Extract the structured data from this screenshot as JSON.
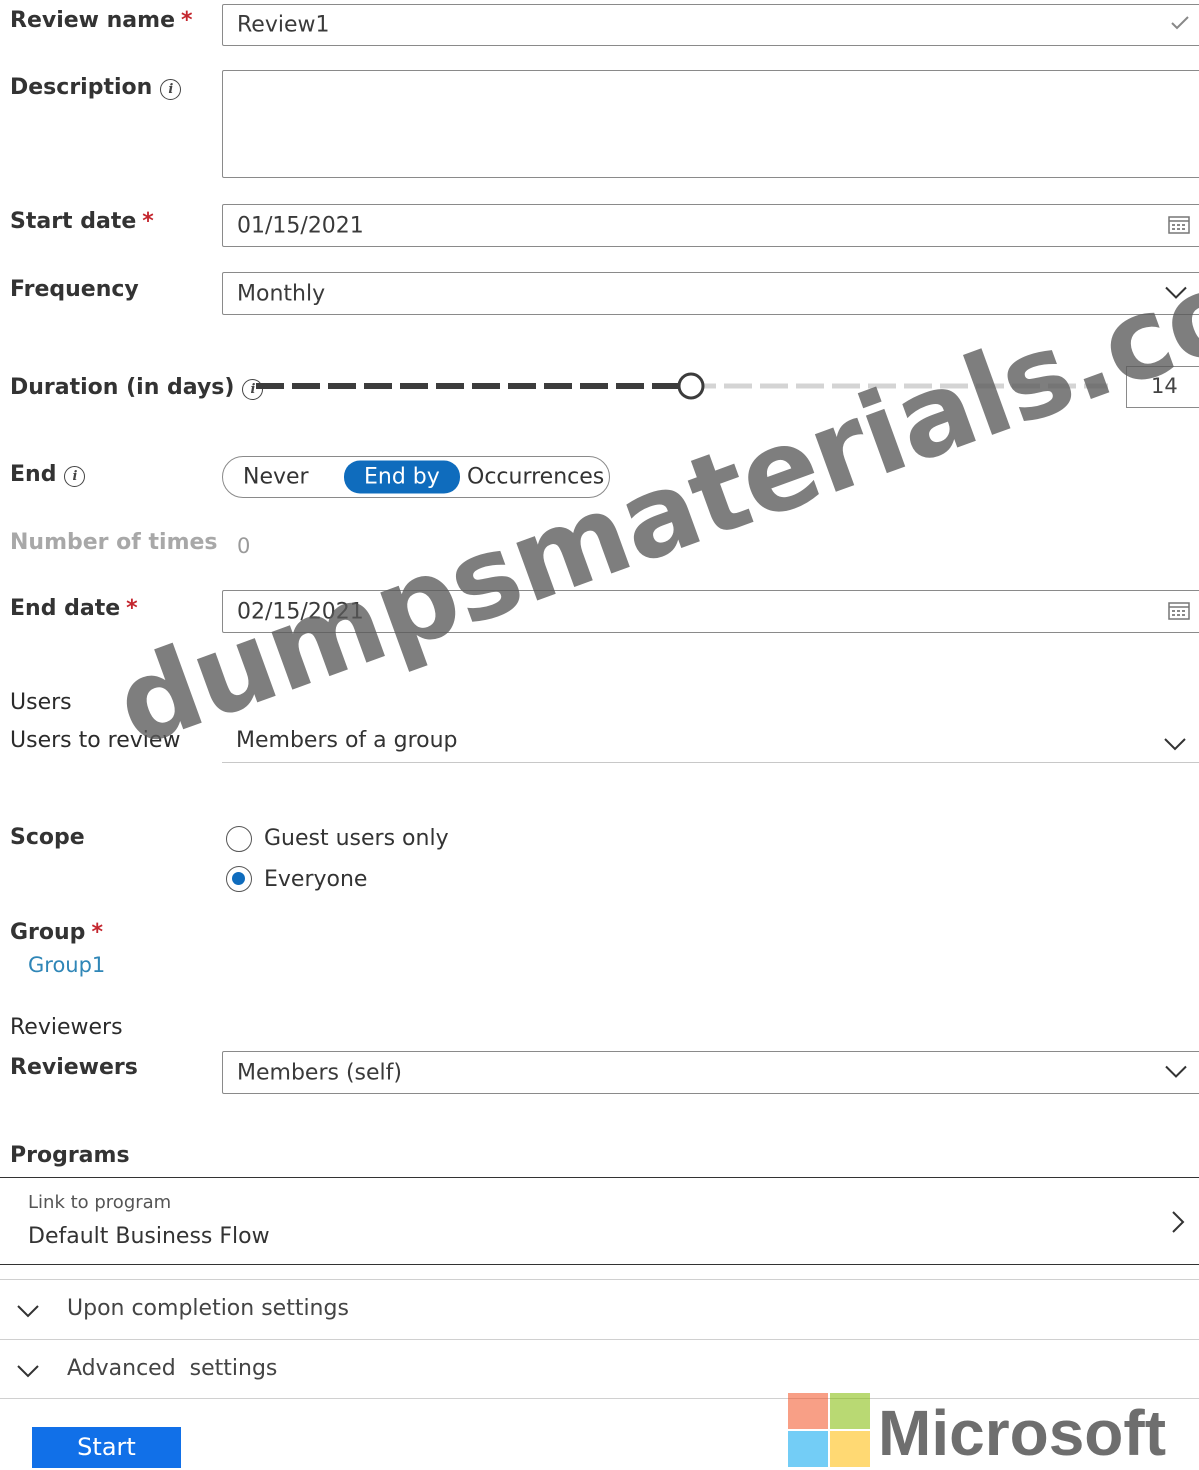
{
  "form": {
    "review_name": {
      "label": "Review name",
      "required": "*",
      "value": "Review1"
    },
    "description": {
      "label": "Description",
      "value": ""
    },
    "start_date": {
      "label": "Start date",
      "required": "*",
      "value": "01/15/2021"
    },
    "frequency": {
      "label": "Frequency",
      "value": "Monthly"
    },
    "duration": {
      "label": "Duration (in days)",
      "value": "14",
      "slider_fraction": 0.51
    },
    "end": {
      "label": "End",
      "options": [
        "Never",
        "End by",
        "Occurrences"
      ],
      "selected": "End by"
    },
    "number_of_times": {
      "label": "Number of times",
      "value": "0"
    },
    "end_date": {
      "label": "End date",
      "required": "*",
      "value": "02/15/2021"
    }
  },
  "users": {
    "section_title": "Users",
    "users_to_review": {
      "label": "Users to review",
      "value": "Members of a group"
    },
    "scope": {
      "label": "Scope",
      "options": [
        "Guest users only",
        "Everyone"
      ],
      "selected": "Everyone"
    },
    "group": {
      "label": "Group",
      "required": "*",
      "value": "Group1"
    }
  },
  "reviewers": {
    "section_title": "Reviewers",
    "reviewers_field": {
      "label": "Reviewers",
      "value": "Members (self)"
    }
  },
  "programs": {
    "section_title": "Programs",
    "link_label": "Link to program",
    "link_value": "Default Business Flow"
  },
  "collapsibles": {
    "upon_completion": "Upon completion settings",
    "advanced": "Advanced  settings"
  },
  "actions": {
    "start": "Start"
  },
  "watermark": "dumpsmaterials.com",
  "branding": {
    "logo_text": "Microsoft",
    "colors": {
      "red": "#f25022",
      "green": "#7fba00",
      "blue": "#00a4ef",
      "yellow": "#ffb900"
    }
  },
  "colors": {
    "accent": "#0f6cbd",
    "link": "#2f86b7",
    "required": "#c4262e"
  }
}
